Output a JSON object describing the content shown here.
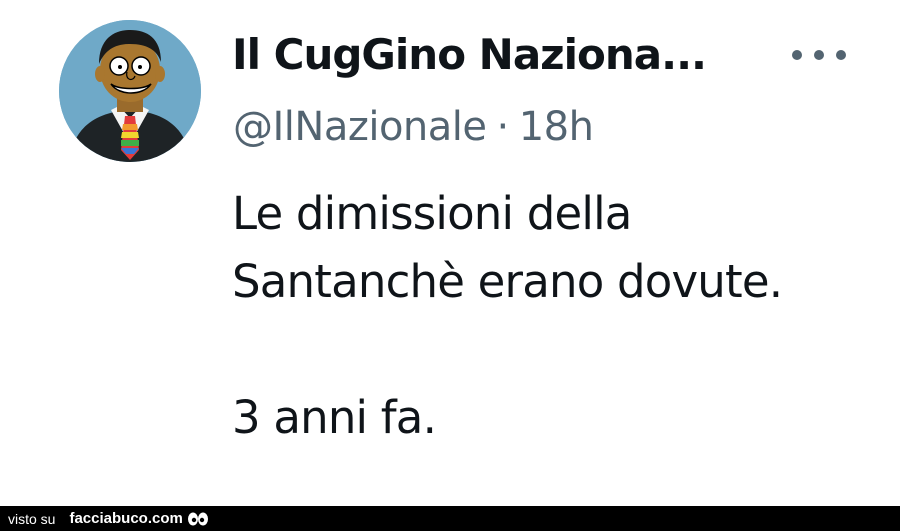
{
  "tweet": {
    "display_name": "Il CugGino Naziona...",
    "handle": "@IlNazionale",
    "separator": "·",
    "time": "18h",
    "text_lines": [
      "Le dimissioni della",
      "Santanchè erano dovute."
    ],
    "text_footer": "3 anni fa."
  },
  "icons": {
    "more": "more-options-icon",
    "avatar": "cartoon-avatar"
  },
  "footer": {
    "prefix": "visto su",
    "brand": "facciabuco.com"
  },
  "colors": {
    "text_primary": "#0f1419",
    "text_secondary": "#536471",
    "footer_bg": "#000000"
  }
}
